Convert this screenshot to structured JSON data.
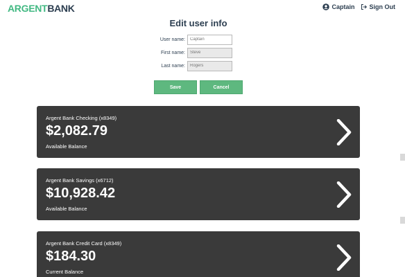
{
  "header": {
    "logo_part1": "ARGENT",
    "logo_part2": "BANK",
    "user_name": "Captain",
    "sign_out": "Sign Out",
    "user_icon": "user-circle-icon",
    "signout_icon": "sign-out-icon"
  },
  "form": {
    "title": "Edit user info",
    "username_label": "User name:",
    "username_value": "Captain",
    "firstname_label": "First name:",
    "firstname_value": "Steve",
    "lastname_label": "Last name:",
    "lastname_value": "Rogers",
    "save_label": "Save",
    "cancel_label": "Cancel"
  },
  "accounts": [
    {
      "title": "Argent Bank Checking (x8349)",
      "amount": "$2,082.79",
      "description": "Available Balance"
    },
    {
      "title": "Argent Bank Savings (x6712)",
      "amount": "$10,928.42",
      "description": "Available Balance"
    },
    {
      "title": "Argent Bank Credit Card (x8349)",
      "amount": "$184.30",
      "description": "Current Balance"
    }
  ],
  "colors": {
    "brand_green": "#42b983",
    "button_green": "#5eb87f",
    "card_bg": "#3a3a3a",
    "text_dark": "#2c3e50"
  }
}
